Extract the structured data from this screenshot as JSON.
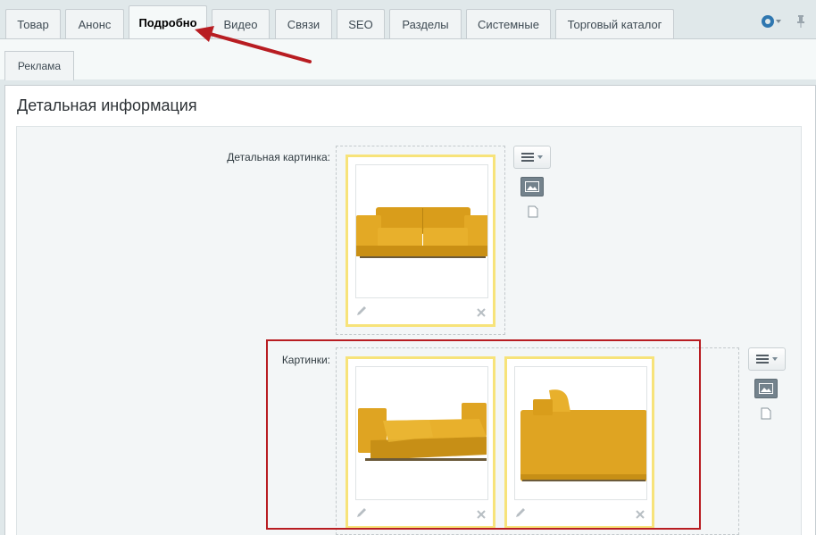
{
  "tabs": [
    {
      "label": "Товар"
    },
    {
      "label": "Анонс"
    },
    {
      "label": "Подробно"
    },
    {
      "label": "Видео"
    },
    {
      "label": "Связи"
    },
    {
      "label": "SEO"
    },
    {
      "label": "Разделы"
    },
    {
      "label": "Системные"
    },
    {
      "label": "Торговый каталог"
    }
  ],
  "active_tab": "Подробно",
  "subtabs": [
    {
      "label": "Реклама"
    }
  ],
  "section": {
    "title": "Детальная информация"
  },
  "fields": {
    "detail_picture": {
      "label": "Детальная картинка:"
    },
    "pictures": {
      "label": "Картинки:"
    }
  },
  "colors": {
    "accent": "#2f77b0",
    "card_border": "#f7e37a",
    "highlight_frame": "#b81d22",
    "arrow": "#b81d22",
    "sofa": "#e0a826"
  },
  "icons": {
    "settings": "gear-icon",
    "pin": "pin-icon",
    "menu": "menu-lines-icon",
    "image_mode": "image-icon",
    "file_mode": "file-icon",
    "edit": "pencil-icon",
    "delete": "close-icon"
  }
}
